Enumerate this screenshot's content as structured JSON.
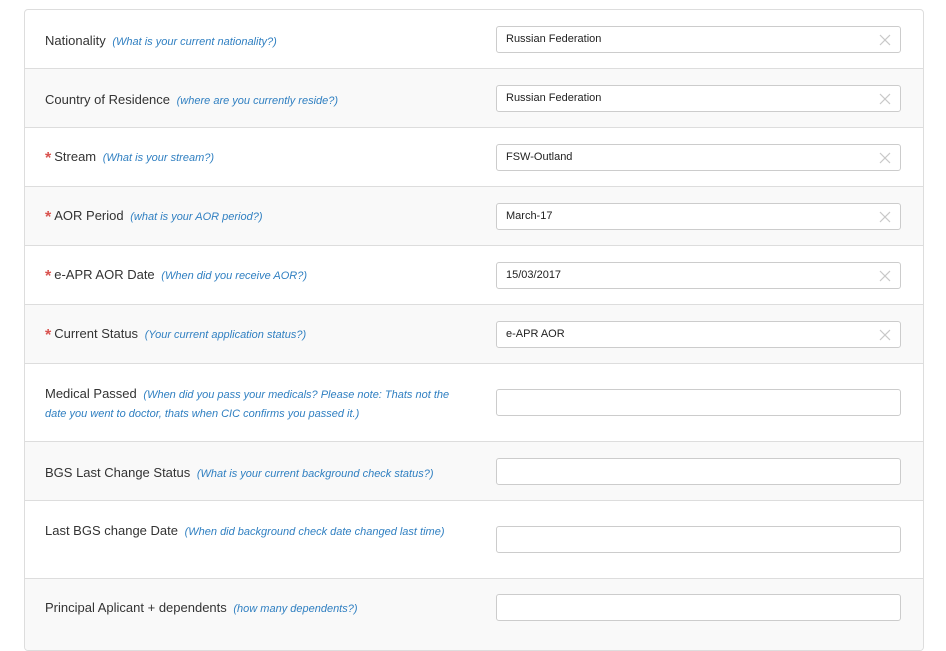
{
  "rows": [
    {
      "label": "Nationality",
      "hint": "(What is your current nationality?)",
      "required": false,
      "value": "Russian Federation",
      "clearable": true
    },
    {
      "label": "Country of Residence",
      "hint": "(where are you currently reside?)",
      "required": false,
      "value": "Russian Federation",
      "clearable": true
    },
    {
      "label": "Stream",
      "hint": "(What is your stream?)",
      "required": true,
      "value": "FSW-Outland",
      "clearable": true
    },
    {
      "label": "AOR Period",
      "hint": "(what is your AOR period?)",
      "required": true,
      "value": "March-17",
      "clearable": true
    },
    {
      "label": "e-APR AOR Date",
      "hint": "(When did you receive AOR?)",
      "required": true,
      "value": "15/03/2017",
      "clearable": true
    },
    {
      "label": "Current Status",
      "hint": "(Your current application status?)",
      "required": true,
      "value": "e-APR AOR",
      "clearable": true
    },
    {
      "label": "Medical Passed",
      "hint": "(When did you pass your medicals? Please note: Thats not the date you went to doctor, thats when CIC confirms you passed it.)",
      "required": false,
      "value": "",
      "clearable": false
    },
    {
      "label": "BGS Last Change Status",
      "hint": "(What is your current background check status?)",
      "required": false,
      "value": "",
      "clearable": false
    },
    {
      "label": "Last BGS change Date",
      "hint": "(When did background check date changed last time)",
      "required": false,
      "value": "",
      "clearable": false
    },
    {
      "label": "Principal Aplicant + dependents",
      "hint": "(how many dependents?)",
      "required": false,
      "value": "",
      "clearable": false
    }
  ],
  "required_marker": "*",
  "icons": {
    "clear": "close-icon"
  },
  "colors": {
    "hint": "#2f7fc1",
    "required": "#d9534f",
    "border": "#dddddd",
    "alt_row": "#f9f9f9"
  }
}
